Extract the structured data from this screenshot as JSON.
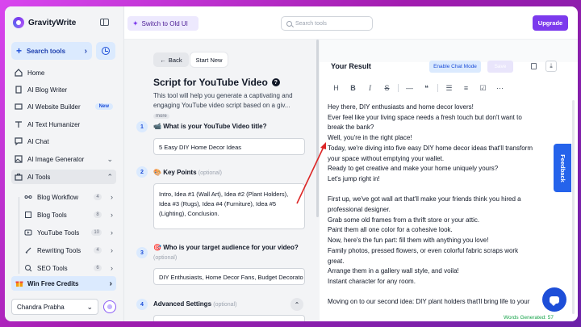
{
  "app": {
    "name": "GravityWrite"
  },
  "sidebar": {
    "search_label": "Search tools",
    "nav": [
      {
        "label": "Home"
      },
      {
        "label": "AI Blog Writer"
      },
      {
        "label": "AI Website Builder",
        "badge": "New"
      },
      {
        "label": "AI Text Humanizer"
      },
      {
        "label": "AI Chat"
      },
      {
        "label": "AI Image Generator"
      },
      {
        "label": "AI Tools"
      }
    ],
    "sub": [
      {
        "label": "Blog Workflow",
        "count": "4"
      },
      {
        "label": "Blog Tools",
        "count": "8"
      },
      {
        "label": "YouTube Tools",
        "count": "10"
      },
      {
        "label": "Rewriting Tools",
        "count": "4"
      },
      {
        "label": "SEO Tools",
        "count": "6"
      }
    ],
    "win_credits": "Win Free Credits",
    "user": "Chandra Prabha"
  },
  "topbar": {
    "switch_label": "Switch to Old UI",
    "search_placeholder": "Search tools",
    "upgrade_label": "Upgrade"
  },
  "form": {
    "back_label": "Back",
    "start_new_label": "Start New",
    "title": "Script for YouTube Video",
    "description": "This tool will help you generate a captivating and engaging YouTube video script based on a giv...",
    "more_label": "more",
    "steps": [
      {
        "num": "1",
        "emoji": "📹",
        "label": "What is your YouTube Video title?",
        "optional": "",
        "value": "5 Easy DIY Home Decor Ideas"
      },
      {
        "num": "2",
        "emoji": "🎨",
        "label": "Key Points",
        "optional": "(optional)",
        "value": "Intro, Idea #1 (Wall Art), Idea #2 (Plant Holders), Idea #3 (Rugs), Idea #4 (Furniture), Idea #5 (Lighting), Conclusion."
      },
      {
        "num": "3",
        "emoji": "🎯",
        "label": "Who is your target audience for your video?",
        "optional": "(optional)",
        "value": "DIY Enthusiasts, Home Decor Fans, Budget Decorato"
      },
      {
        "num": "4",
        "emoji": "",
        "label": "Advanced Settings",
        "optional": "(optional)",
        "value": ""
      }
    ]
  },
  "result": {
    "title": "Your Result",
    "chat_mode_label": "Enable Chat Mode",
    "save_label": "Save",
    "toolbar": [
      "H",
      "B",
      "I",
      "S",
      "—",
      "❝",
      "☰",
      "≡",
      "☑",
      "⋯"
    ],
    "lines": [
      "Hey there, DIY enthusiasts and home decor lovers!",
      "Ever feel like your living space needs a fresh touch but don't want to",
      "break the bank?",
      "Well, you're in the right place!",
      "Today, we're diving into five easy DIY home decor ideas that'll transform",
      "your space without emptying your wallet.",
      "Ready to get creative and make your home uniquely yours?",
      "Let's jump right in!",
      "",
      "First up, we've got wall art that'll make your friends think you hired a",
      "professional designer.",
      "Grab some old frames from a thrift store or your attic.",
      "Paint them all one color for a cohesive look.",
      "Now, here's the fun part: fill them with anything you love!",
      "Family photos, pressed flowers, or even colorful fabric scraps work",
      "great.",
      "Arrange them in a gallery wall style, and voila!",
      "Instant character for any room.",
      "",
      "Moving on to our second idea: DIY plant holders that'll bring life to your"
    ],
    "words_generated": "Words Generated: 57"
  },
  "feedback_label": "Feedback",
  "colors": {
    "accent": "#7c3aed",
    "primary_blue": "#2563eb",
    "annotation_arrow": "#dc2626"
  }
}
